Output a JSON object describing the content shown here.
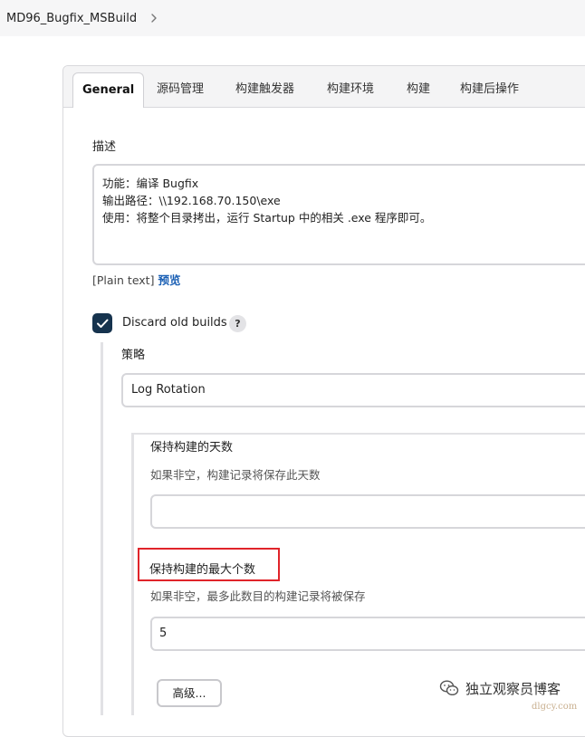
{
  "breadcrumb": {
    "project": "MD96_Bugfix_MSBuild",
    "chevron_icon": "chevron-right-icon"
  },
  "tabs": [
    {
      "label": "General"
    },
    {
      "label": "源码管理"
    },
    {
      "label": "构建触发器"
    },
    {
      "label": "构建环境"
    },
    {
      "label": "构建"
    },
    {
      "label": "构建后操作"
    }
  ],
  "description": {
    "label": "描述",
    "lines": [
      "功能：编译 Bugfix",
      "输出路径：\\\\192.168.70.150\\exe",
      "使用：将整个目录拷出，运行 Startup 中的相关 .exe 程序即可。"
    ],
    "format": "[Plain text]",
    "preview_label": "预览"
  },
  "discard_old_builds": {
    "label": "Discard old builds",
    "checked": true,
    "help": "?"
  },
  "strategy": {
    "label": "策略",
    "value": "Log Rotation"
  },
  "days_to_keep": {
    "label": "保持构建的天数",
    "hint": "如果非空，构建记录将保存此天数",
    "value": ""
  },
  "max_builds": {
    "label": "保持构建的最大个数",
    "hint": "如果非空，最多此数目的构建记录将被保存",
    "value": "5",
    "highlight_color": "#e0242a"
  },
  "advanced_button": "高级...",
  "watermark": {
    "text": "独立观察员博客",
    "url": "dlgcy.com"
  },
  "colors": {
    "checkbox": "#16334e",
    "link": "#1a5fb4"
  }
}
